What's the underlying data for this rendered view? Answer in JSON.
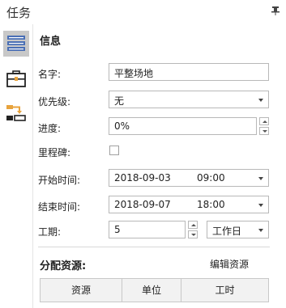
{
  "panel": {
    "title": "任务"
  },
  "sidebar": {
    "items": [
      {
        "icon": "info-list-icon",
        "active": true
      },
      {
        "icon": "briefcase-icon",
        "active": false
      },
      {
        "icon": "resource-assign-icon",
        "active": false
      }
    ]
  },
  "info": {
    "section_title": "信息",
    "name_label": "名字:",
    "name_value": "平整场地",
    "priority_label": "优先级:",
    "priority_value": "无",
    "progress_label": "进度:",
    "progress_value": "0%",
    "milestone_label": "里程碑:",
    "milestone_checked": false,
    "start_label": "开始时间:",
    "start_date": "2018-09-03",
    "start_time": "09:00",
    "end_label": "结束时间:",
    "end_date": "2018-09-07",
    "end_time": "18:00",
    "duration_label": "工期:",
    "duration_value": "5",
    "duration_unit": "工作日"
  },
  "resources": {
    "section_title": "分配资源:",
    "edit_label": "编辑资源",
    "columns": [
      "资源",
      "单位",
      "工时"
    ]
  }
}
